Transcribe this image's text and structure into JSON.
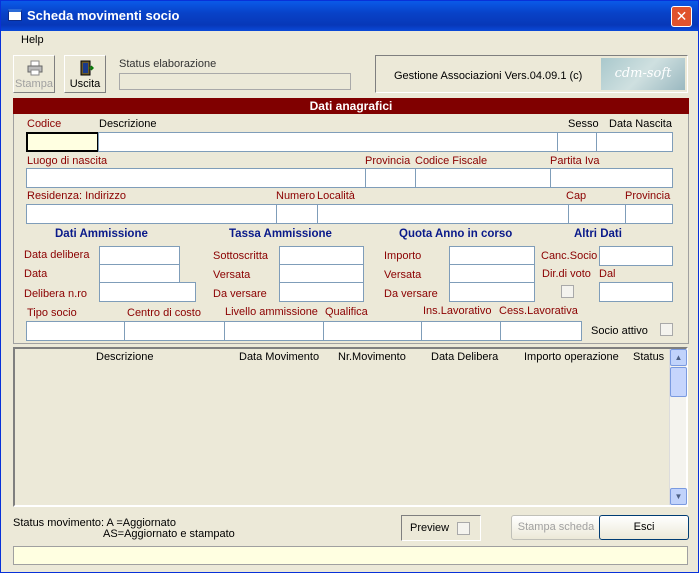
{
  "window": {
    "title": "Scheda movimenti socio",
    "close_glyph": "✕"
  },
  "menu": {
    "help": "Help"
  },
  "toolbar": {
    "print": {
      "label": "Stampa",
      "icon": "printer-icon",
      "enabled": false
    },
    "exit": {
      "label": "Uscita",
      "icon": "exit-door-icon",
      "enabled": true
    },
    "status_label": "Status elaborazione",
    "version_text": "Gestione Associazioni Vers.04.09.1 (c)",
    "logo_text": "cdm-soft"
  },
  "section_title": "Dati anagrafici",
  "anagrafica": {
    "codice": "Codice",
    "descrizione": "Descrizione",
    "sesso": "Sesso",
    "data_nascita": "Data Nascita",
    "luogo_nascita": "Luogo di nascita",
    "provincia": "Provincia",
    "codice_fiscale": "Codice Fiscale",
    "partita_iva": "Partita Iva",
    "residenza": "Residenza: Indirizzo",
    "numero": "Numero",
    "localita": "Località",
    "cap": "Cap",
    "provincia2": "Provincia"
  },
  "headings": {
    "dati_ammissione": "Dati Ammissione",
    "tassa_ammissione": "Tassa Ammissione",
    "quota_anno": "Quota Anno in corso",
    "altri_dati": "Altri Dati"
  },
  "ammissione": {
    "data_delibera": "Data delibera",
    "data": "Data",
    "delibera_nro": "Delibera n.ro"
  },
  "tassa": {
    "sottoscritta": "Sottoscritta",
    "versata": "Versata",
    "da_versare": "Da versare"
  },
  "quota": {
    "importo": "Importo",
    "versata": "Versata",
    "da_versare": "Da versare"
  },
  "altri": {
    "canc_socio": "Canc.Socio",
    "dir_voto": "Dir.di voto",
    "dal": "Dal"
  },
  "lavoro": {
    "tipo_socio": "Tipo socio",
    "centro_costo": "Centro di costo",
    "livello": "Livello ammissione",
    "qualifica": "Qualifica",
    "ins_lavorativo": "Ins.Lavorativo",
    "cess_lavorativa": "Cess.Lavorativa",
    "socio_attivo": "Socio attivo"
  },
  "grid": {
    "columns": [
      "Descrizione",
      "Data Movimento",
      "Nr.Movimento",
      "Data Delibera",
      "Importo operazione",
      "Status"
    ],
    "rows": []
  },
  "footer": {
    "status_line1": "Status movimento: A  =Aggiornato",
    "status_line2": "AS=Aggiornato e stampato",
    "preview": "Preview",
    "stampa_scheda": "Stampa scheda",
    "esci": "Esci"
  }
}
